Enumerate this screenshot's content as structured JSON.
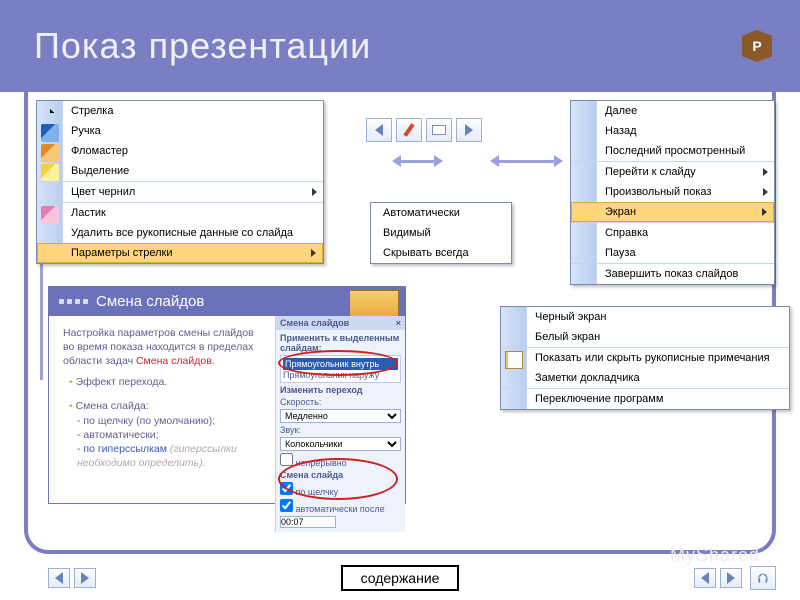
{
  "title": "Показ презентации",
  "badge": "P",
  "pointer_menu": {
    "items": [
      {
        "label": "Стрелка",
        "key": "С",
        "icon": "cursor"
      },
      {
        "label": "Ручка",
        "key": "Р",
        "icon": "pen"
      },
      {
        "label": "Фломастер",
        "key": "Ф",
        "icon": "marker"
      },
      {
        "label": "Выделение",
        "key": "В",
        "icon": "high"
      }
    ],
    "ink_color": "Цвет чернил",
    "eraser": "Ластик",
    "erase_all": "Удалить все рукописные данные со слайда",
    "arrow_options": "Параметры стрелки"
  },
  "arrow_submenu": [
    "Автоматически",
    "Видимый",
    "Скрывать всегда"
  ],
  "context_menu": {
    "next": "Далее",
    "back": "Назад",
    "last_viewed": "Последний просмотренный",
    "goto": "Перейти к слайду",
    "custom": "Произвольный показ",
    "screen": "Экран",
    "help": "Справка",
    "pause": "Пауза",
    "end": "Завершить показ слайдов"
  },
  "screen_submenu": {
    "black": "Черный экран",
    "white": "Белый экран",
    "ink_notes": "Показать или скрыть рукописные примечания",
    "speaker_notes": "Заметки докладчика",
    "switch": "Переключение программ"
  },
  "panel": {
    "heading": "Смена слайдов",
    "intro1": "Настройка параметров смены слайдов во время показа находится в пределах области задач ",
    "intro_red": "Смена слайдов.",
    "bullets_title": "Эффект перехода.",
    "bullets_head": "Смена слайда:",
    "b1": "- по щелчку (по умолчанию);",
    "b2": "- автоматически;",
    "b3_a": "- по гиперссылкам ",
    "b3_b": "(гиперссылки необходимо определить).",
    "pane_title": "Смена слайдов",
    "apply_label": "Применить к выделенным слайдам:",
    "opt1": "Прямоугольник внутрь",
    "opt2": "Прямоугольник наружу",
    "change_label": "Изменить переход",
    "speed_label": "Скорость:",
    "speed_value": "Медленно",
    "sound_label": "Звук:",
    "sound_value": "Колокольчики",
    "loop_label": "непрерывно",
    "advance_label": "Смена слайда",
    "on_click": "по щелчку",
    "auto_after": "автоматически после",
    "time": "00:07"
  },
  "footer": {
    "content": "содержание"
  },
  "watermark": "MyShared"
}
